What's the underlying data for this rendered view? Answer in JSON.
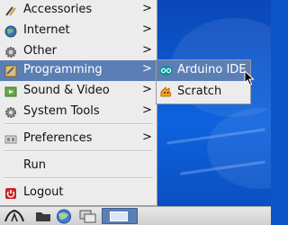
{
  "menu": {
    "items": [
      {
        "label": "Accessories",
        "icon": "accessories-icon",
        "has_submenu": true
      },
      {
        "label": "Internet",
        "icon": "globe-icon",
        "has_submenu": true
      },
      {
        "label": "Other",
        "icon": "gear-icon",
        "has_submenu": true
      },
      {
        "label": "Programming",
        "icon": "programming-icon",
        "has_submenu": true,
        "selected": true
      },
      {
        "label": "Sound & Video",
        "icon": "multimedia-icon",
        "has_submenu": true
      },
      {
        "label": "System Tools",
        "icon": "gear-icon",
        "has_submenu": true
      },
      {
        "label": "Preferences",
        "icon": "preferences-icon",
        "has_submenu": true
      },
      {
        "label": "Run",
        "icon": "",
        "has_submenu": false
      },
      {
        "label": "Logout",
        "icon": "logout-icon",
        "has_submenu": false
      }
    ],
    "arrow": ">"
  },
  "submenu": {
    "items": [
      {
        "label": "Arduino IDE",
        "icon": "arduino-icon",
        "selected": true
      },
      {
        "label": "Scratch",
        "icon": "scratch-icon"
      }
    ]
  },
  "taskbar": {
    "icons": [
      "raspberry-menu-icon",
      "file-manager-icon",
      "browser-icon",
      "window-switch-icon",
      "active-window-icon"
    ]
  },
  "colors": {
    "selection": "#5b7fb5",
    "menu_bg": "#ececec",
    "desktop": "#0b55c8"
  }
}
